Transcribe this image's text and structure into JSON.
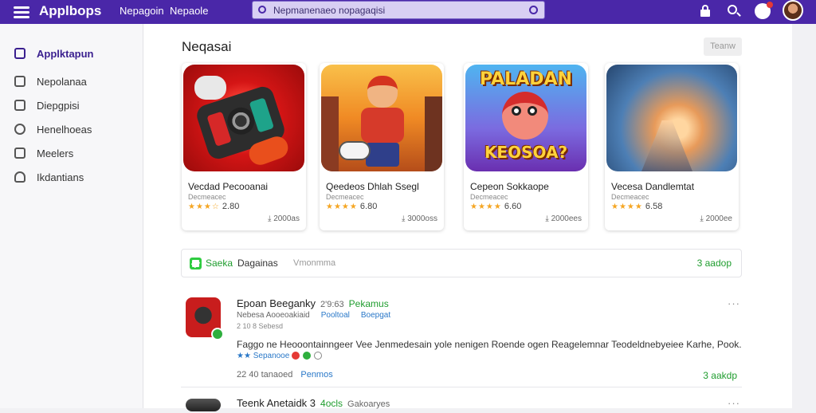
{
  "topbar": {
    "brand": "Applbops",
    "nav": [
      "Nepagoin",
      "Nepaole"
    ],
    "search_placeholder": "Nepmanenaeo nopagaqisi",
    "icons": [
      "menu-icon",
      "lock-icon",
      "search-icon",
      "notification-icon",
      "avatar"
    ]
  },
  "sidebar": {
    "items": [
      {
        "label": "Applktapun",
        "icon": "home-icon",
        "active": true
      },
      {
        "label": "Nepolanaa",
        "icon": "folder-icon"
      },
      {
        "label": "Diepgpisi",
        "icon": "chart-icon"
      },
      {
        "label": "Henelhoeas",
        "icon": "chat-icon"
      },
      {
        "label": "Meelers",
        "icon": "gamepad-icon"
      },
      {
        "label": "Ikdantians",
        "icon": "user-icon"
      }
    ]
  },
  "main": {
    "section_title": "Neqasai",
    "view_button": "Teanw",
    "cards": [
      {
        "name": "Vecdad Pecooanai",
        "dev": "Decmeacec",
        "stars": "★★★☆",
        "rating": "2.80",
        "downloads": "2000as"
      },
      {
        "name": "Qeedeos Dhlah Ssegl",
        "dev": "Decmeacec",
        "stars": "★★★★",
        "rating": "6.80",
        "downloads": "3000oss"
      },
      {
        "name": "Cepeon Sokkaope",
        "dev": "Decmeacec",
        "stars": "★★★★",
        "rating": "6.60",
        "downloads": "2000ees",
        "art_text_top": "PALADAN",
        "art_text_bottom": "KEOSOA?"
      },
      {
        "name": "Vecesa Dandlemtat",
        "dev": "Decmeacec",
        "stars": "★★★★",
        "rating": "6.58",
        "downloads": "2000ee"
      }
    ],
    "banner": {
      "label": "Saeka",
      "text": "Dagainas",
      "muted": "Vmonmma",
      "action": "3 aadop"
    },
    "listings": [
      {
        "title": "Epoan Beeganky",
        "version": "2'9:63",
        "tag": "Pekamus",
        "subtitle": "Nebesa Aooeoakiaid",
        "link1": "Pooltoal",
        "link2": "Boepgat",
        "sub2": "2 10 8 Sebesd",
        "description": "Faggo ne Heooontainngeer Vee Jenmedesain yole nenigen Roende ogen Reagelemnar Teodeldnebyeiee Karhe, Pook.",
        "meta": "★★ Sepanooe",
        "foot": "22 40 tanaoed",
        "foot_link": "Penmos",
        "action": "3 aakdp"
      },
      {
        "title": "Teenk Anetaidk 3",
        "version": "",
        "tag": "4ocls",
        "muted": "Gakoaryes"
      }
    ]
  }
}
